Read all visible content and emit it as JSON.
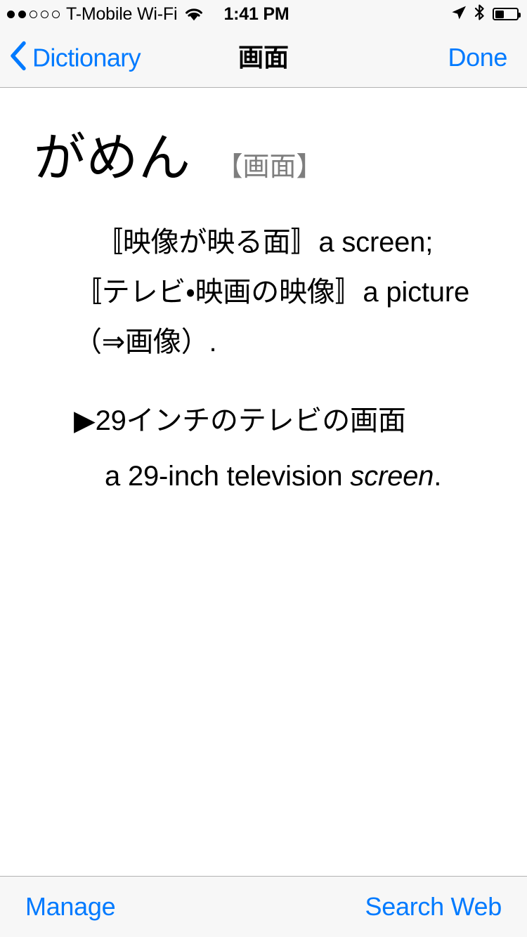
{
  "status_bar": {
    "signal_dots_total": 5,
    "signal_dots_filled": 2,
    "carrier": "T-Mobile Wi-Fi",
    "wifi_icon": "wifi-icon",
    "time": "1:41 PM",
    "location_icon": "location-arrow-icon",
    "bluetooth_icon": "bluetooth-icon",
    "battery_icon": "battery-icon",
    "battery_level_percent": 40
  },
  "nav_bar": {
    "back_icon": "chevron-left-icon",
    "back_label": "Dictionary",
    "title": "画面",
    "done_label": "Done"
  },
  "entry": {
    "headword": "がめん",
    "headword_kanji": "【画面】",
    "sense": "〚映像が映る面〛a screen; 〚テレビ・映画の映像〛a picture（⇒画像）.",
    "example": {
      "bullet": "▶",
      "japanese": "29インチのテレビの画面",
      "english_before_italic": "a 29-inch television ",
      "english_italic": "screen",
      "english_after_italic": "."
    }
  },
  "toolbar": {
    "manage_label": "Manage",
    "search_web_label": "Search Web"
  },
  "colors": {
    "accent_blue": "#007aff",
    "chrome_gray": "#f7f7f7",
    "separator": "#b2b2b2",
    "kanji_gray": "#7e7e7e"
  }
}
